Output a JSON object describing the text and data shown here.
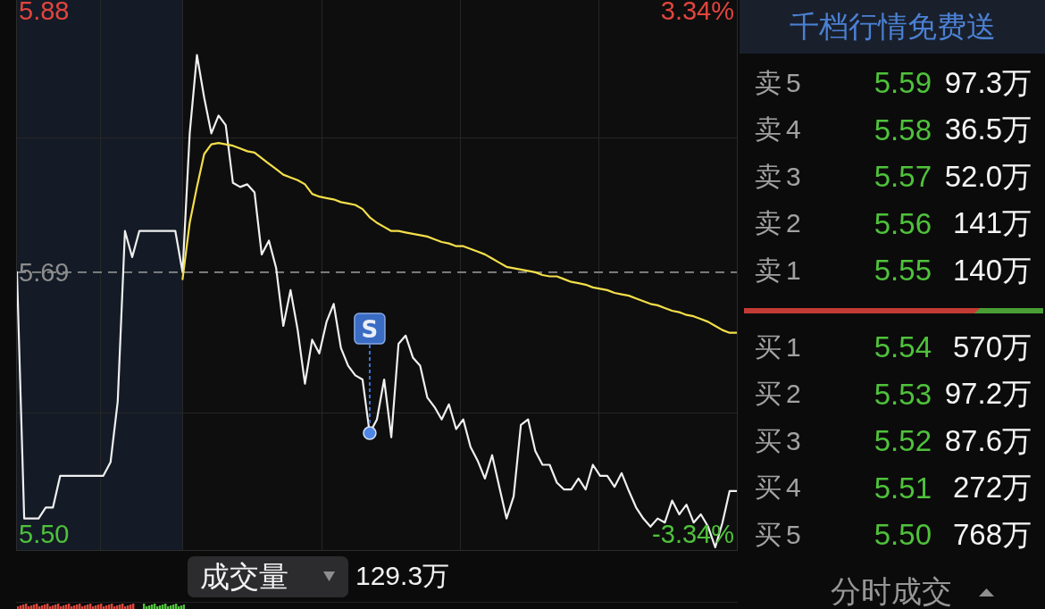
{
  "chart": {
    "chart_data": [
      {
        "type": "line",
        "ylim": [
          5.488,
          5.888
        ],
        "y2lim": [
          -3.55,
          3.48
        ],
        "yticks": [
          {
            "value": 5.88,
            "label": "5.88"
          },
          {
            "value": 5.69,
            "label": "5.69"
          },
          {
            "value": 5.5,
            "label": "5.50"
          }
        ],
        "y2ticks": [
          {
            "value": 3.34,
            "label": "3.34%"
          },
          {
            "value": -3.34,
            "label": "-3.34%"
          }
        ],
        "grid": true,
        "ref_lines": [
          {
            "axis": "y",
            "value": 5.69,
            "line_style": "dashed",
            "color": "#8a8a8a"
          }
        ],
        "series": [
          {
            "color": "#f0f0f0",
            "values": [
              5.69,
              5.511,
              5.511,
              5.511,
              5.519,
              5.519,
              5.542,
              5.542,
              5.542,
              5.542,
              5.542,
              5.542,
              5.542,
              5.552,
              5.596,
              5.72,
              5.701,
              5.72,
              5.72,
              5.72,
              5.72,
              5.72,
              5.72,
              5.69,
              5.791,
              5.848,
              5.817,
              5.791,
              5.804,
              5.797,
              5.755,
              5.752,
              5.754,
              5.748,
              5.703,
              5.713,
              5.693,
              5.651,
              5.677,
              5.648,
              5.609,
              5.641,
              5.631,
              5.654,
              5.667,
              5.635,
              5.622,
              5.615,
              5.612,
              5.573,
              5.583,
              5.612,
              5.57,
              5.638,
              5.644,
              5.628,
              5.622,
              5.599,
              5.592,
              5.583,
              5.594,
              5.576,
              5.583,
              5.563,
              5.553,
              5.54,
              5.557,
              5.534,
              5.511,
              5.527,
              5.579,
              5.583,
              5.56,
              5.55,
              5.55,
              5.537,
              5.532,
              5.532,
              5.54,
              5.532,
              5.55,
              5.542,
              5.542,
              5.534,
              5.544,
              5.531,
              5.519,
              5.511,
              5.505,
              5.511,
              5.508,
              5.524,
              5.514,
              5.521,
              5.508,
              5.514,
              5.505,
              5.49,
              5.508,
              5.531,
              5.531
            ]
          },
          {
            "color": "#f3df4a",
            "values": [
              null,
              null,
              null,
              null,
              null,
              null,
              null,
              null,
              null,
              null,
              null,
              null,
              null,
              null,
              null,
              null,
              null,
              null,
              null,
              null,
              null,
              null,
              null,
              5.685,
              5.726,
              5.752,
              5.776,
              5.783,
              5.784,
              5.783,
              5.782,
              5.78,
              5.778,
              5.777,
              5.773,
              5.769,
              5.765,
              5.761,
              5.759,
              5.757,
              5.754,
              5.747,
              5.745,
              5.744,
              5.743,
              5.741,
              5.74,
              5.739,
              5.736,
              5.73,
              5.726,
              5.723,
              5.72,
              5.72,
              5.719,
              5.718,
              5.717,
              5.716,
              5.714,
              5.712,
              5.711,
              5.709,
              5.709,
              5.707,
              5.705,
              5.703,
              5.7,
              5.697,
              5.694,
              5.693,
              5.692,
              5.691,
              5.69,
              5.688,
              5.687,
              5.687,
              5.685,
              5.683,
              5.682,
              5.681,
              5.679,
              5.678,
              5.677,
              5.675,
              5.674,
              5.673,
              5.671,
              5.669,
              5.667,
              5.666,
              5.664,
              5.662,
              5.661,
              5.659,
              5.658,
              5.656,
              5.654,
              5.651,
              5.648,
              5.646,
              5.646
            ]
          }
        ],
        "annotations": [
          "S"
        ]
      }
    ]
  },
  "volume_pane": {
    "indicator_label": "成交量",
    "reading": "129.3万"
  },
  "order_book": {
    "banner": "千档行情免费送",
    "asks": [
      {
        "label": "卖5",
        "price": "5.59",
        "volume": "97.3万"
      },
      {
        "label": "卖4",
        "price": "5.58",
        "volume": "36.5万"
      },
      {
        "label": "卖3",
        "price": "5.57",
        "volume": "52.0万"
      },
      {
        "label": "卖2",
        "price": "5.56",
        "volume": "141万"
      },
      {
        "label": "卖1",
        "price": "5.55",
        "volume": "140万"
      }
    ],
    "ratio_bar": {
      "level": 0.79
    },
    "bids": [
      {
        "label": "买1",
        "price": "5.54",
        "volume": "570万"
      },
      {
        "label": "买2",
        "price": "5.53",
        "volume": "97.2万"
      },
      {
        "label": "买3",
        "price": "5.52",
        "volume": "87.6万"
      },
      {
        "label": "买4",
        "price": "5.51",
        "volume": "272万"
      },
      {
        "label": "买5",
        "price": "5.50",
        "volume": "768万"
      }
    ],
    "trades_toggle": "分时成交"
  }
}
